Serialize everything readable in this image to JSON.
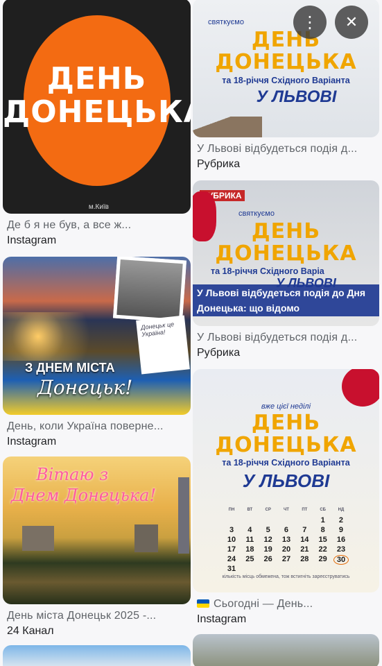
{
  "results": [
    {
      "id": "r1",
      "title_lines": [
        "ДЕНЬ",
        "ДОНЕЦЬКА"
      ],
      "corner_text": "м.Київ",
      "caption": "Де б я не був, а все ж...",
      "source": "Instagram"
    },
    {
      "id": "r2",
      "caption": "День, коли Україна поверне...",
      "source": "Instagram",
      "poster_line1": "З ДНЕМ МІСТА",
      "poster_line2": "Донецьк!",
      "note_text": "Донецьк це Україна!"
    },
    {
      "id": "r3",
      "caption": "День міста Донецьк 2025 -...",
      "source": "24 Канал",
      "poster_line1": "Вітаю з",
      "poster_line2": "Днем Донецька!"
    },
    {
      "id": "r4",
      "caption": "У Львові відбудеться подія д...",
      "source": "Рубрика",
      "kicker": "святкуємо",
      "title_lines": [
        "ДЕНЬ",
        "ДОНЕЦЬКА"
      ],
      "sub": "та 18-річчя Східного Варіанта",
      "city": "У ЛЬВОВІ"
    },
    {
      "id": "r5",
      "caption": "У Львові відбудеться подія д...",
      "source": "Рубрика",
      "brand": "РУБРИКА",
      "kicker": "святкуємо",
      "title_lines": [
        "ДЕНЬ",
        "ДОНЕЦЬКА"
      ],
      "sub": "та 18-річчя Східного Варіа",
      "city": "У ЛЬВОВІ",
      "banner_lines": [
        "У Львові відбудеться подія до Дня",
        "Донецька: що відомо"
      ]
    },
    {
      "id": "r6",
      "caption": "Сьогодні — День...",
      "source": "Instagram",
      "kicker": "вже цієї неділі",
      "title_lines": [
        "ДЕНЬ",
        "ДОНЕЦЬКА"
      ],
      "sub": "та 18-річчя Східного Варіанта",
      "city": "У ЛЬВОВІ",
      "weekdays": [
        "ПН",
        "ВТ",
        "СР",
        "ЧТ",
        "ПТ",
        "СБ",
        "НД"
      ],
      "calendar": [
        [
          "",
          "",
          "",
          "",
          "",
          "1",
          "2"
        ],
        [
          "3",
          "4",
          "5",
          "6",
          "7",
          "8",
          "9"
        ],
        [
          "10",
          "11",
          "12",
          "13",
          "14",
          "15",
          "16"
        ],
        [
          "17",
          "18",
          "19",
          "20",
          "21",
          "22",
          "23"
        ],
        [
          "24",
          "25",
          "26",
          "27",
          "28",
          "29",
          "30"
        ],
        [
          "31",
          "",
          "",
          "",
          "",
          "",
          ""
        ]
      ],
      "highlight": "30",
      "footnote": "кількість місць обмежена, тож встигніть зареєструватись"
    }
  ],
  "overlay": {
    "more_icon": "more-vert-icon",
    "close_icon": "close-icon"
  },
  "colors": {
    "orange": "#f36b12",
    "blue": "#1f3a93",
    "gold": "#f0a500",
    "ua_blue": "#0057b7",
    "ua_yellow": "#ffd700"
  }
}
